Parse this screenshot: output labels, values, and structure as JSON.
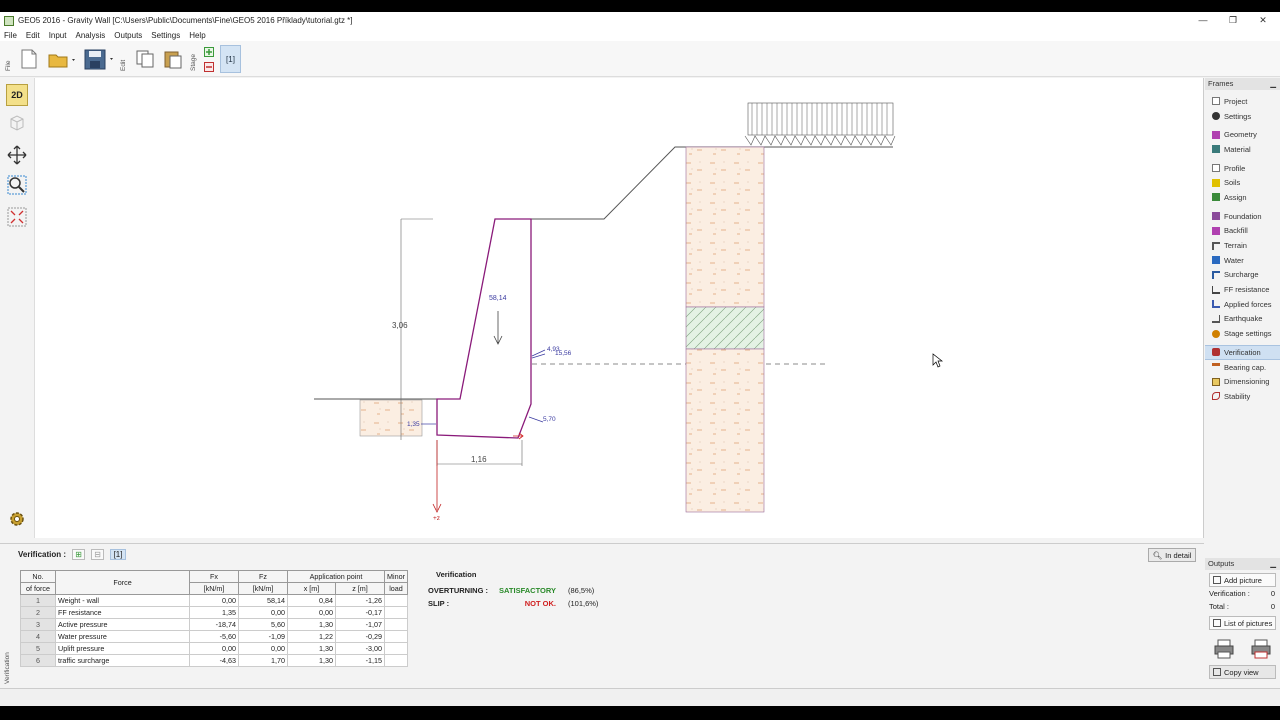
{
  "window": {
    "title": "GEO5 2016 - Gravity Wall [C:\\Users\\Public\\Documents\\Fine\\GEO5 2016 Příklady\\tutorial.gtz *]",
    "minimize": "—",
    "restore": "❐",
    "close": "✕"
  },
  "menu": [
    "File",
    "Edit",
    "Input",
    "Analysis",
    "Outputs",
    "Settings",
    "Help"
  ],
  "toolbar": {
    "file_group": "File",
    "edit_group": "Edit",
    "stage_group": "Stage",
    "stage_tab": "[1]"
  },
  "left_tools": {
    "view2d": "2D",
    "view3d": "3D"
  },
  "drawing": {
    "dim_height": "3,06",
    "dim_width": "1,16",
    "weight_label": "58,14",
    "active_label_1": "4,93",
    "active_label_2": "15,56",
    "base_label": "5,70",
    "ff_label": "1,35",
    "axis_label": "+z"
  },
  "frames": {
    "header": "Frames",
    "groups": [
      [
        {
          "label": "Project",
          "color": "#777"
        },
        {
          "label": "Settings",
          "color": "#333"
        }
      ],
      [
        {
          "label": "Geometry",
          "color": "#b040b0"
        },
        {
          "label": "Material",
          "color": "#3a7a7a"
        }
      ],
      [
        {
          "label": "Profile",
          "color": "#777"
        },
        {
          "label": "Soils",
          "color": "#c8a000"
        },
        {
          "label": "Assign",
          "color": "#3a8a3a"
        }
      ],
      [
        {
          "label": "Foundation",
          "color": "#8a4a9a"
        },
        {
          "label": "Backfill",
          "color": "#b040b0"
        },
        {
          "label": "Terrain",
          "color": "#555"
        },
        {
          "label": "Water",
          "color": "#2a6ac0"
        },
        {
          "label": "Surcharge",
          "color": "#2a5aa0"
        },
        {
          "label": "FF resistance",
          "color": "#444"
        },
        {
          "label": "Applied forces",
          "color": "#3a5ab0"
        },
        {
          "label": "Earthquake",
          "color": "#555"
        },
        {
          "label": "Stage settings",
          "color": "#d08000"
        }
      ],
      [
        {
          "label": "Verification",
          "color": "#b03030",
          "active": true
        },
        {
          "label": "Bearing cap.",
          "color": "#c06020"
        },
        {
          "label": "Dimensioning",
          "color": "#806020"
        },
        {
          "label": "Stability",
          "color": "#b03030"
        }
      ]
    ]
  },
  "verification_panel": {
    "title": "Verification :",
    "stage": "[1]",
    "in_detail": "In detail",
    "side_label": "Verification",
    "table": {
      "headers": {
        "no": "No.",
        "of_force": "of force",
        "force": "Force",
        "fx": "Fx",
        "fz": "Fz",
        "app_point": "Application point",
        "minor": "Minor",
        "load": "load",
        "fx_unit": "[kN/m]",
        "fz_unit": "[kN/m]",
        "x_unit": "x [m]",
        "z_unit": "z [m]"
      },
      "rows": [
        {
          "no": "1",
          "force": "Weight - wall",
          "fx": "0,00",
          "fz": "58,14",
          "x": "0,84",
          "z": "-1,26",
          "minor": ""
        },
        {
          "no": "2",
          "force": "FF resistance",
          "fx": "1,35",
          "fz": "0,00",
          "x": "0,00",
          "z": "-0,17",
          "minor": ""
        },
        {
          "no": "3",
          "force": "Active pressure",
          "fx": "-18,74",
          "fz": "5,60",
          "x": "1,30",
          "z": "-1,07",
          "minor": ""
        },
        {
          "no": "4",
          "force": "Water pressure",
          "fx": "-5,60",
          "fz": "-1,09",
          "x": "1,22",
          "z": "-0,29",
          "minor": ""
        },
        {
          "no": "5",
          "force": "Uplift pressure",
          "fx": "0,00",
          "fz": "0,00",
          "x": "1,30",
          "z": "-3,00",
          "minor": ""
        },
        {
          "no": "6",
          "force": "traffic surcharge",
          "fx": "-4,63",
          "fz": "1,70",
          "x": "1,30",
          "z": "-1,15",
          "minor": ""
        }
      ]
    },
    "results": {
      "header": "Verification",
      "rows": [
        {
          "label": "OVERTURNING :",
          "result": "SATISFACTORY",
          "pct": "(86,5%)",
          "color": "#2a8a2a"
        },
        {
          "label": "SLIP :",
          "result": "NOT OK.",
          "pct": "(101,6%)",
          "color": "#d02020"
        }
      ]
    }
  },
  "outputs": {
    "header": "Outputs",
    "add_picture": "Add picture",
    "verification_label": "Verification :",
    "verification_count": "0",
    "total_label": "Total :",
    "total_count": "0",
    "list_pictures": "List of pictures",
    "copy_view": "Copy view"
  }
}
